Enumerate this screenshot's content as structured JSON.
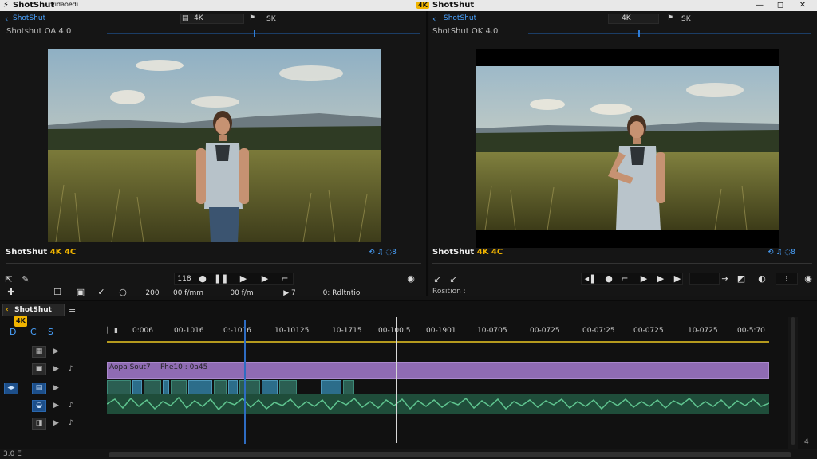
{
  "titlebar": {
    "left_title": "ShotShut",
    "left_subtitle": "vidəoedi",
    "right_badge": "4K",
    "right_title": "ShotShut",
    "window_controls": [
      "—",
      "◻",
      "✕"
    ]
  },
  "left_monitor": {
    "back_label": "ShotShut",
    "field1": "4K",
    "field2": "SK",
    "subtitle": "Shotshut OA  4.0",
    "caption_name": "ShotShut",
    "caption_badge": "4K  4C",
    "caption_icons": "⟲ ♫ ◌8",
    "controls": {
      "rate": "118",
      "timecode1": "200",
      "timecode2": "00 f/mm",
      "timecode3": "00 f/m",
      "step": "▶ 7",
      "status": "0: Rdltntio"
    }
  },
  "right_monitor": {
    "back_label": "ShotShut",
    "field1": "4K",
    "field2": "SK",
    "subtitle": "ShotShut OK  4.0",
    "caption_name": "ShotShut",
    "caption_badge": "4K  4C",
    "caption_icons": "⟲ ♫ ◌8",
    "status": "Rosition :"
  },
  "timeline": {
    "tab_label": "ShotShut",
    "tab_badge": "4K",
    "timecodes": [
      "0:006",
      "00-1016",
      "0:-1016",
      "10-10125",
      "10-1715",
      "00-100.5",
      "00-1901",
      "10-0705",
      "00-0725",
      "00-07:25",
      "00-0725",
      "10-0725",
      "00-5:70"
    ],
    "clip_label_1": "Aopa Sout7",
    "clip_label_2": "Fhe10 : 0a45",
    "track_buttons": [
      "D",
      "C",
      "S"
    ],
    "bottom_left": "3.0  E",
    "bottom_right": "4"
  },
  "colors": {
    "accent_blue": "#2f7ed8",
    "accent_yellow": "#f0b400",
    "clip_purple": "#8f6bb3",
    "audio_green": "#3f9a6a"
  }
}
